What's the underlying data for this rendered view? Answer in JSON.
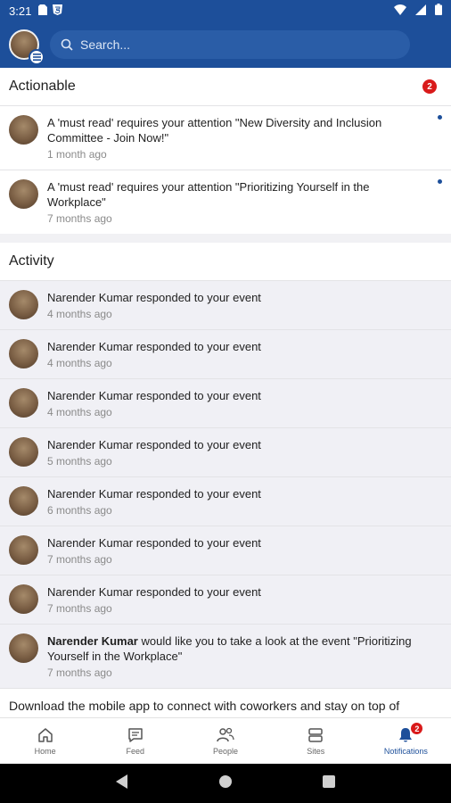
{
  "statusbar": {
    "time": "3:21"
  },
  "search": {
    "placeholder": "Search..."
  },
  "actionable": {
    "title": "Actionable",
    "count": "2",
    "items": [
      {
        "text": "A 'must read' requires your attention \"New Diversity and Inclusion Committee - Join Now!\"",
        "time": "1 month ago"
      },
      {
        "text": "A 'must read' requires your attention \"Prioritizing Yourself in the Workplace\"",
        "time": "7 months ago"
      }
    ]
  },
  "activity": {
    "title": "Activity",
    "items": [
      {
        "text": "Narender Kumar responded to your event",
        "time": "4 months ago"
      },
      {
        "text": "Narender Kumar responded to your event",
        "time": "4 months ago"
      },
      {
        "text": "Narender Kumar responded to your event",
        "time": "4 months ago"
      },
      {
        "text": "Narender Kumar responded to your event",
        "time": "5 months ago"
      },
      {
        "text": "Narender Kumar responded to your event",
        "time": "6 months ago"
      },
      {
        "text": "Narender Kumar responded to your event",
        "time": "7 months ago"
      },
      {
        "text": "Narender Kumar responded to your event",
        "time": "7 months ago"
      }
    ],
    "last": {
      "name": "Narender Kumar",
      "rest": " would like you to take a look at the event \"Prioritizing Yourself in the Workplace\"",
      "time": "7 months ago"
    }
  },
  "banner": {
    "text": "Download the mobile app to connect with coworkers and stay on top of company news"
  },
  "nav": {
    "home": "Home",
    "feed": "Feed",
    "people": "People",
    "sites": "Sites",
    "notifications": "Notifications",
    "notifications_badge": "2"
  },
  "colors": {
    "brand": "#1d4f9a",
    "badge": "#d91a1a"
  }
}
